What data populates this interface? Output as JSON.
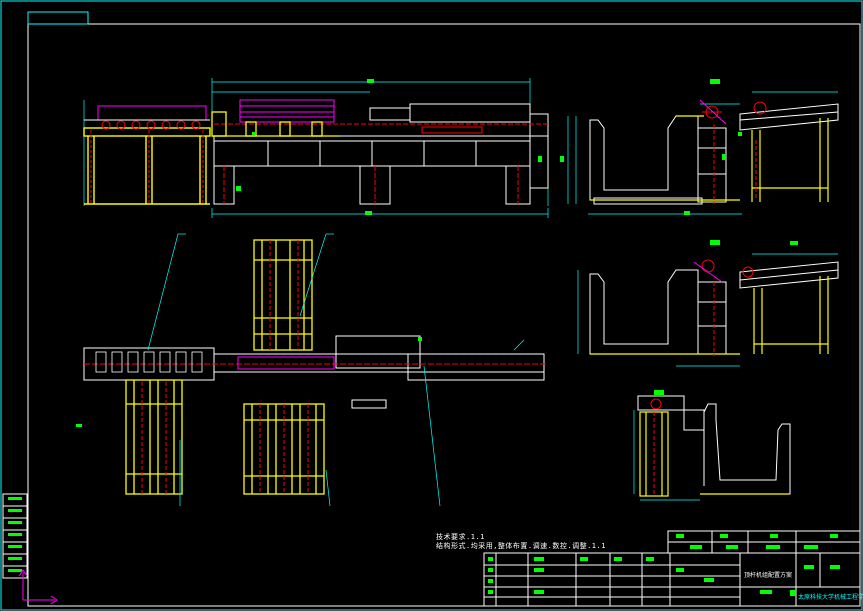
{
  "drawing": {
    "background": "#000000",
    "colors": {
      "frame": "#ffffff",
      "cyan": "#00ffff",
      "yellow": "#ffff00",
      "red": "#ff0000",
      "green": "#00ff00",
      "magenta": "#ff00ff",
      "white": "#ffffff"
    },
    "notes": {
      "line1": "技术要求.1.1",
      "line2": "结构形式.均采用,整体布置.调速.数控.调整.1.1"
    },
    "title_block": {
      "drawing_title": "顶杆机组配置方案",
      "company": "太原科技大学机械工程学院"
    }
  }
}
